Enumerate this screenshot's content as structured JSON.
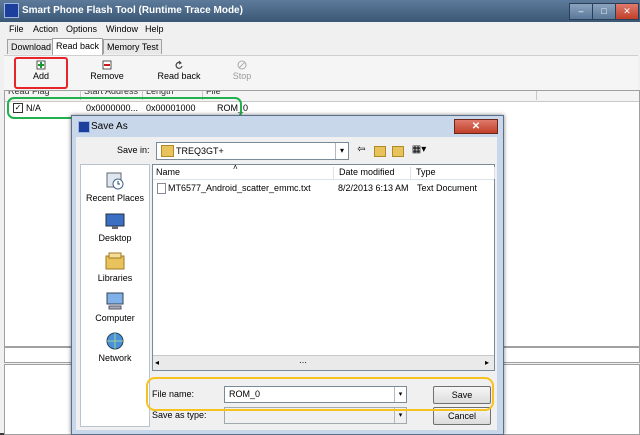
{
  "main": {
    "title": "Smart Phone Flash Tool (Runtime Trace Mode)",
    "window_controls": {
      "minimize": "–",
      "maximize": "□",
      "close": "✕"
    },
    "menu": [
      "File",
      "Action",
      "Options",
      "Window",
      "Help"
    ],
    "tabs": [
      "Download",
      "Read back",
      "Memory Test"
    ],
    "active_tab": "Read back",
    "toolbar": {
      "add": "Add",
      "remove": "Remove",
      "read_back": "Read back",
      "stop": "Stop"
    },
    "table": {
      "headers": [
        "Read Flag",
        "Start Address",
        "Length",
        "File"
      ],
      "rows": [
        {
          "flag": "N/A",
          "start": "0x0000000...",
          "length": "0x00001000",
          "file": "ROM_0"
        }
      ]
    }
  },
  "dialog": {
    "title": "Save As",
    "close": "✕",
    "save_in_label": "Save in:",
    "save_in_value": "TREQ3GT+",
    "places": [
      "Recent Places",
      "Desktop",
      "Libraries",
      "Computer",
      "Network"
    ],
    "file_headers": [
      "Name",
      "Date modified",
      "Type"
    ],
    "files": [
      {
        "name": "MT6577_Android_scatter_emmc.txt",
        "date": "8/2/2013 6:13 AM",
        "type": "Text Document"
      }
    ],
    "file_name_label": "File name:",
    "file_name_value": "ROM_0",
    "save_as_type_label": "Save as type:",
    "save_button": "Save",
    "cancel_button": "Cancel"
  },
  "colors": {
    "annotation_red": "#e8242a",
    "annotation_green": "#22b14c",
    "annotation_yellow": "#f7c21e"
  }
}
